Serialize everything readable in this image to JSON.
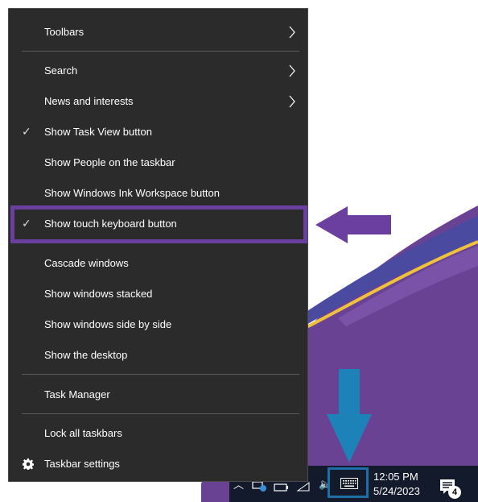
{
  "menu": {
    "items": [
      {
        "label": "Toolbars",
        "submenu": true,
        "checked": false
      },
      {
        "label": "Search",
        "submenu": true,
        "checked": false
      },
      {
        "label": "News and interests",
        "submenu": true,
        "checked": false
      },
      {
        "label": "Show Task View button",
        "submenu": false,
        "checked": true
      },
      {
        "label": "Show People on the taskbar",
        "submenu": false,
        "checked": false
      },
      {
        "label": "Show Windows Ink Workspace button",
        "submenu": false,
        "checked": false
      },
      {
        "label": "Show touch keyboard button",
        "submenu": false,
        "checked": true
      },
      {
        "label": "Cascade windows",
        "submenu": false,
        "checked": false
      },
      {
        "label": "Show windows stacked",
        "submenu": false,
        "checked": false
      },
      {
        "label": "Show windows side by side",
        "submenu": false,
        "checked": false
      },
      {
        "label": "Show the desktop",
        "submenu": false,
        "checked": false
      },
      {
        "label": "Task Manager",
        "submenu": false,
        "checked": false
      },
      {
        "label": "Lock all taskbars",
        "submenu": false,
        "checked": false
      },
      {
        "label": "Taskbar settings",
        "submenu": false,
        "checked": false,
        "icon": "gear-icon"
      }
    ],
    "check_glyph": "✓",
    "submenu_arrow_icon": "chevron-right-icon"
  },
  "taskbar": {
    "clock_time": "12:05 PM",
    "clock_date": "5/24/2023",
    "notification_count": "4",
    "tray_icons": [
      "chevron-up-icon",
      "network-icon",
      "battery-icon",
      "wifi-icon",
      "volume-icon",
      "touch-keyboard-icon",
      "action-center-icon"
    ]
  },
  "annotations": {
    "highlight_color": "#6b3fa0",
    "arrow_left_color": "#6b3fa0",
    "arrow_down_color": "#1d82b8",
    "keyboard_box_color": "#1d6fa5"
  },
  "colors": {
    "menu_bg": "#2b2b2b",
    "wallpaper_purple": "#5b3a8c",
    "wallpaper_yellow": "#f0c23c",
    "taskbar_bg": "#131a2b"
  }
}
